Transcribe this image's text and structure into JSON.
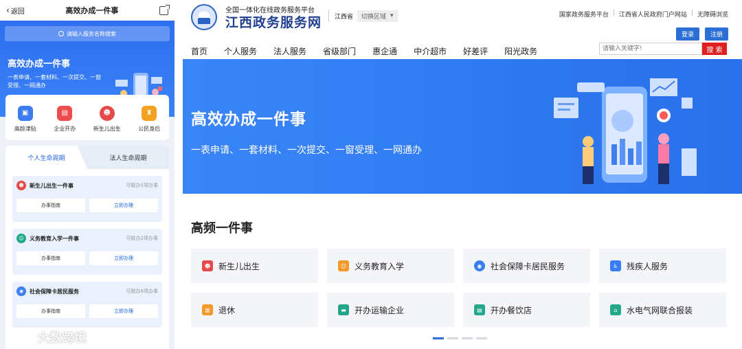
{
  "mobile": {
    "back_label": "返回",
    "title": "高效办成一件事",
    "search_placeholder": "请输入服务名称搜索",
    "hero_title": "高效办成一件事",
    "hero_sub": "一表申请、一套材料、一次提交、一窗受理、一网通办",
    "quick_items": [
      {
        "label": "高龄津贴",
        "icon": "allowance-icon",
        "color": "#3b7df0"
      },
      {
        "label": "企业开办",
        "icon": "business-icon",
        "color": "#ef4d4d"
      },
      {
        "label": "新生儿出生",
        "icon": "baby-icon",
        "color": "#e64b4b"
      },
      {
        "label": "公民身后",
        "icon": "memorial-icon",
        "color": "#f3a11e"
      }
    ],
    "tabs": [
      {
        "label": "个人生命周期"
      },
      {
        "label": "法人生命周期"
      }
    ],
    "cards": [
      {
        "title": "新生儿出生一件事",
        "count": "可联办5项办事",
        "guide": "办事指南",
        "go": "立即办理",
        "color": "#e64b4b"
      },
      {
        "title": "义务教育入学一件事",
        "count": "可联办2项办事",
        "guide": "办事指南",
        "go": "立即办理",
        "color": "#23a98a"
      },
      {
        "title": "社会保障卡居民服务",
        "count": "可联办8项办事",
        "guide": "办事指南",
        "go": "立即办理",
        "color": "#3b7df0"
      }
    ]
  },
  "watermark": {
    "text": "大数跨境"
  },
  "desktop": {
    "brand_small": "全国一体化在线政务服务平台",
    "brand": "江西政务服务网",
    "province": "江西省",
    "switch_label": "切换区域",
    "links": [
      "国家政务服务平台",
      "江西省人民政府门户网站",
      "无障碍浏览"
    ],
    "login": "登录",
    "register": "注册",
    "nav": [
      "首页",
      "个人服务",
      "法人服务",
      "省级部门",
      "惠企通",
      "中介超市",
      "好差评",
      "阳光政务"
    ],
    "search_placeholder": "请输入关键字!",
    "search_btn": "搜 索",
    "banner_title": "高效办成一件事",
    "banner_sub": "一表申请、一套材料、一次提交、一窗受理、一网通办",
    "section_title": "高频一件事",
    "grid": [
      {
        "label": "新生儿出生",
        "icon": "baby-icon",
        "color": "#e64b4b"
      },
      {
        "label": "义务教育入学",
        "icon": "school-icon",
        "color": "#f39a2a"
      },
      {
        "label": "社会保障卡居民服务",
        "icon": "social-card-icon",
        "color": "#3b7df0"
      },
      {
        "label": "残疾人服务",
        "icon": "wheelchair-icon",
        "color": "#3b7df0"
      },
      {
        "label": "退休",
        "icon": "retire-icon",
        "color": "#f39a2a"
      },
      {
        "label": "开办运输企业",
        "icon": "transport-icon",
        "color": "#23a98a"
      },
      {
        "label": "开办餐饮店",
        "icon": "restaurant-icon",
        "color": "#23a98a"
      },
      {
        "label": "水电气网联合报装",
        "icon": "utility-icon",
        "color": "#23a98a"
      }
    ]
  }
}
